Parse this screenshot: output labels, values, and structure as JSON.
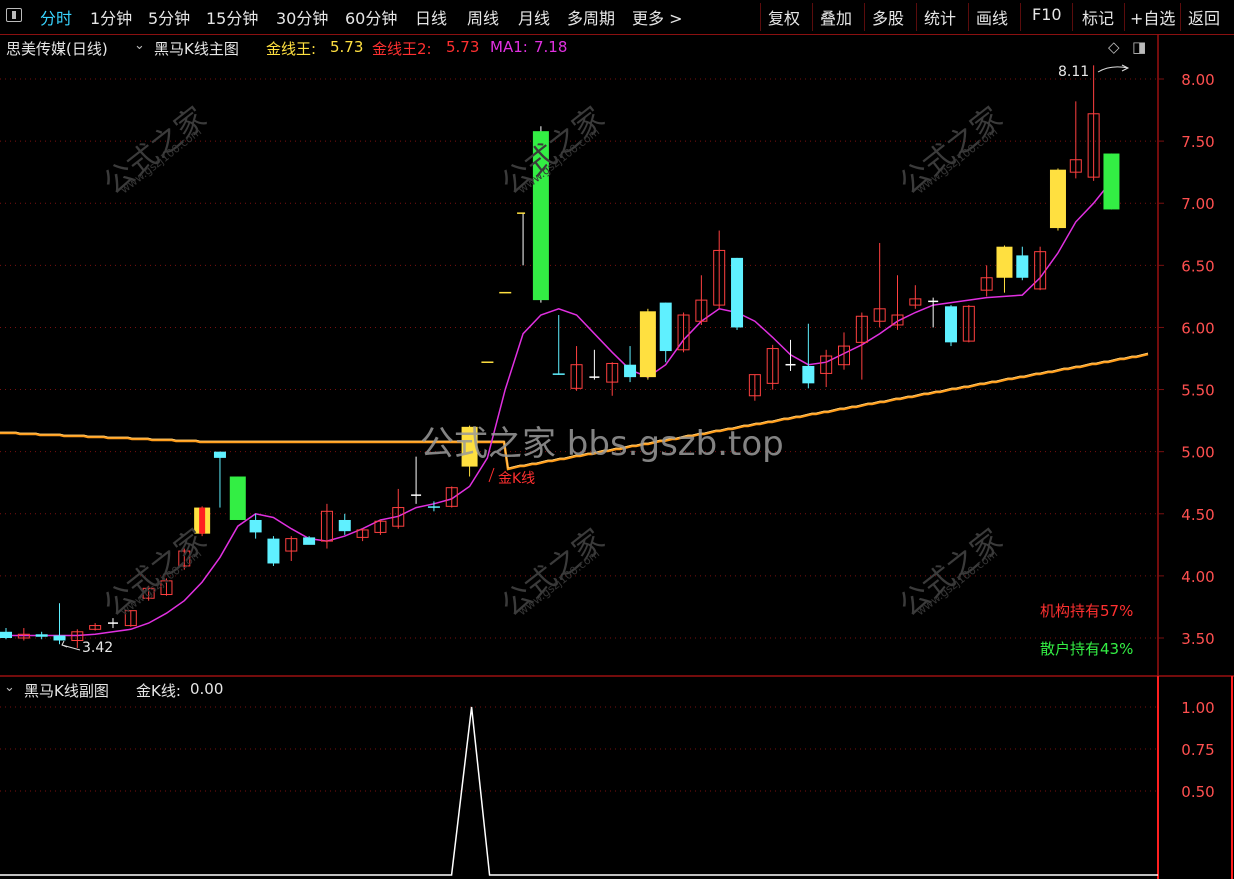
{
  "toolbar": {
    "items": [
      {
        "label": "分时",
        "active": true
      },
      {
        "label": "1分钟"
      },
      {
        "label": "5分钟"
      },
      {
        "label": "15分钟"
      },
      {
        "label": "30分钟"
      },
      {
        "label": "60分钟"
      },
      {
        "label": "日线"
      },
      {
        "label": "周线"
      },
      {
        "label": "月线"
      },
      {
        "label": "多周期"
      },
      {
        "label": "更多 >"
      }
    ],
    "right_buttons": [
      "复权",
      "叠加",
      "多股",
      "统计",
      "画线",
      "F10",
      "标记",
      "+自选",
      "返回"
    ]
  },
  "main_header": {
    "stock": "思美传媒(日线)",
    "indicator": "黑马K线主图",
    "gold1_label": "金线王:",
    "gold1_value": "5.73",
    "gold2_label": "金线王2:",
    "gold2_value": "5.73",
    "ma_label": "MA1:",
    "ma_value": "7.18"
  },
  "sub_header": {
    "indicator": "黑马K线副图",
    "label": "金K线:",
    "value": "0.00"
  },
  "annotations": {
    "high_label": "8.11",
    "low_label": "3.42",
    "gold_k": "金K线",
    "institution": "机构持有57%",
    "retail": "散户持有43%"
  },
  "watermark": {
    "center": "公式之家 bbs.gszb.top",
    "tile_text": "公式之家",
    "tile_url": "www.gszj100.com"
  },
  "colors": {
    "up": "#ff4040",
    "down": "#5ff0ff",
    "ma": "#e030e0",
    "gold_line": "#ff9c1a",
    "signal_yellow": "#ffe040",
    "signal_green": "#33ee44",
    "grid": "#7a1010",
    "axis_text": "#ff5050"
  },
  "chart_data": {
    "main": {
      "type": "candlestick",
      "y_ticks": [
        8.0,
        7.5,
        7.0,
        6.5,
        6.0,
        5.5,
        5.0,
        4.5,
        4.0,
        3.5
      ],
      "candles": [
        {
          "o": 3.55,
          "h": 3.58,
          "l": 3.49,
          "c": 3.5,
          "k": "down"
        },
        {
          "o": 3.5,
          "h": 3.58,
          "l": 3.48,
          "c": 3.53,
          "k": "up"
        },
        {
          "o": 3.53,
          "h": 3.55,
          "l": 3.49,
          "c": 3.51,
          "k": "down"
        },
        {
          "o": 3.52,
          "h": 3.78,
          "l": 3.45,
          "c": 3.48,
          "k": "down"
        },
        {
          "o": 3.48,
          "h": 3.57,
          "l": 3.42,
          "c": 3.55,
          "k": "up"
        },
        {
          "o": 3.57,
          "h": 3.62,
          "l": 3.56,
          "c": 3.6,
          "k": "up"
        },
        {
          "o": 3.62,
          "h": 3.66,
          "l": 3.58,
          "c": 3.62,
          "k": "doji"
        },
        {
          "o": 3.6,
          "h": 3.72,
          "l": 3.59,
          "c": 3.72,
          "k": "up"
        },
        {
          "o": 3.82,
          "h": 3.92,
          "l": 3.8,
          "c": 3.9,
          "k": "up"
        },
        {
          "o": 3.85,
          "h": 3.98,
          "l": 3.84,
          "c": 3.96,
          "k": "up"
        },
        {
          "o": 4.08,
          "h": 4.22,
          "l": 4.05,
          "c": 4.2,
          "k": "up"
        },
        {
          "o": 4.34,
          "h": 4.56,
          "l": 4.32,
          "c": 4.55,
          "k": "sig_red"
        },
        {
          "o": 5.0,
          "h": 5.0,
          "l": 4.55,
          "c": 4.95,
          "k": "down"
        },
        {
          "o": 4.8,
          "h": 4.8,
          "l": 4.45,
          "c": 4.45,
          "k": "sig_green"
        },
        {
          "o": 4.45,
          "h": 4.5,
          "l": 4.3,
          "c": 4.35,
          "k": "down"
        },
        {
          "o": 4.3,
          "h": 4.32,
          "l": 4.08,
          "c": 4.1,
          "k": "down"
        },
        {
          "o": 4.2,
          "h": 4.32,
          "l": 4.12,
          "c": 4.3,
          "k": "up"
        },
        {
          "o": 4.31,
          "h": 4.32,
          "l": 4.26,
          "c": 4.25,
          "k": "down"
        },
        {
          "o": 4.28,
          "h": 4.58,
          "l": 4.22,
          "c": 4.52,
          "k": "up"
        },
        {
          "o": 4.45,
          "h": 4.5,
          "l": 4.33,
          "c": 4.36,
          "k": "down"
        },
        {
          "o": 4.31,
          "h": 4.38,
          "l": 4.28,
          "c": 4.37,
          "k": "up"
        },
        {
          "o": 4.35,
          "h": 4.45,
          "l": 4.33,
          "c": 4.44,
          "k": "up"
        },
        {
          "o": 4.4,
          "h": 4.7,
          "l": 4.38,
          "c": 4.55,
          "k": "up"
        },
        {
          "o": 4.65,
          "h": 4.96,
          "l": 4.58,
          "c": 4.65,
          "k": "doji"
        },
        {
          "o": 4.56,
          "h": 4.6,
          "l": 4.52,
          "c": 4.55,
          "k": "down"
        },
        {
          "o": 4.56,
          "h": 4.72,
          "l": 4.55,
          "c": 4.71,
          "k": "up"
        },
        {
          "o": 4.88,
          "h": 5.21,
          "l": 4.8,
          "c": 5.2,
          "k": "sig_yellow"
        },
        {
          "o": 5.72,
          "h": 5.72,
          "l": 5.72,
          "c": 5.72,
          "k": "flat_yellow"
        },
        {
          "o": 6.28,
          "h": 6.28,
          "l": 6.28,
          "c": 6.28,
          "k": "flat_yellow"
        },
        {
          "o": 6.92,
          "h": 6.92,
          "l": 6.5,
          "c": 6.92,
          "k": "tick_yellow"
        },
        {
          "o": 7.58,
          "h": 7.62,
          "l": 6.2,
          "c": 6.22,
          "k": "sig_green"
        },
        {
          "o": 5.63,
          "h": 6.1,
          "l": 5.62,
          "c": 5.63,
          "k": "down"
        },
        {
          "o": 5.51,
          "h": 5.85,
          "l": 5.49,
          "c": 5.7,
          "k": "up"
        },
        {
          "o": 5.6,
          "h": 5.82,
          "l": 5.58,
          "c": 5.6,
          "k": "doji"
        },
        {
          "o": 5.56,
          "h": 5.72,
          "l": 5.45,
          "c": 5.71,
          "k": "up"
        },
        {
          "o": 5.7,
          "h": 5.85,
          "l": 5.56,
          "c": 5.6,
          "k": "down"
        },
        {
          "o": 5.6,
          "h": 6.15,
          "l": 5.58,
          "c": 6.13,
          "k": "sig_yellow"
        },
        {
          "o": 6.2,
          "h": 6.2,
          "l": 5.72,
          "c": 5.81,
          "k": "down"
        },
        {
          "o": 5.82,
          "h": 6.12,
          "l": 5.8,
          "c": 6.1,
          "k": "up"
        },
        {
          "o": 6.05,
          "h": 6.42,
          "l": 6.02,
          "c": 6.22,
          "k": "up"
        },
        {
          "o": 6.18,
          "h": 6.78,
          "l": 6.15,
          "c": 6.62,
          "k": "up"
        },
        {
          "o": 6.56,
          "h": 6.56,
          "l": 5.98,
          "c": 6.0,
          "k": "down"
        },
        {
          "o": 5.45,
          "h": 5.62,
          "l": 5.41,
          "c": 5.62,
          "k": "up"
        },
        {
          "o": 5.55,
          "h": 5.86,
          "l": 5.5,
          "c": 5.83,
          "k": "up"
        },
        {
          "o": 5.68,
          "h": 5.9,
          "l": 5.65,
          "c": 5.7,
          "k": "doji"
        },
        {
          "o": 5.69,
          "h": 6.03,
          "l": 5.51,
          "c": 5.55,
          "k": "down"
        },
        {
          "o": 5.63,
          "h": 5.82,
          "l": 5.52,
          "c": 5.77,
          "k": "up"
        },
        {
          "o": 5.7,
          "h": 5.96,
          "l": 5.66,
          "c": 5.85,
          "k": "up"
        },
        {
          "o": 5.88,
          "h": 6.12,
          "l": 5.58,
          "c": 6.09,
          "k": "up"
        },
        {
          "o": 6.05,
          "h": 6.68,
          "l": 6.0,
          "c": 6.15,
          "k": "up"
        },
        {
          "o": 6.02,
          "h": 6.42,
          "l": 5.98,
          "c": 6.1,
          "k": "up"
        },
        {
          "o": 6.18,
          "h": 6.34,
          "l": 6.15,
          "c": 6.23,
          "k": "up"
        },
        {
          "o": 6.2,
          "h": 6.24,
          "l": 6.0,
          "c": 6.21,
          "k": "doji"
        },
        {
          "o": 6.17,
          "h": 6.18,
          "l": 5.85,
          "c": 5.88,
          "k": "down"
        },
        {
          "o": 5.89,
          "h": 6.18,
          "l": 5.88,
          "c": 6.17,
          "k": "up"
        },
        {
          "o": 6.3,
          "h": 6.5,
          "l": 6.25,
          "c": 6.4,
          "k": "up"
        },
        {
          "o": 6.4,
          "h": 6.66,
          "l": 6.28,
          "c": 6.65,
          "k": "sig_yellow"
        },
        {
          "o": 6.58,
          "h": 6.65,
          "l": 6.38,
          "c": 6.4,
          "k": "down"
        },
        {
          "o": 6.31,
          "h": 6.65,
          "l": 6.3,
          "c": 6.61,
          "k": "up"
        },
        {
          "o": 6.8,
          "h": 7.28,
          "l": 6.78,
          "c": 7.27,
          "k": "sig_yellow"
        },
        {
          "o": 7.25,
          "h": 7.82,
          "l": 7.2,
          "c": 7.35,
          "k": "up"
        },
        {
          "o": 7.21,
          "h": 8.11,
          "l": 7.18,
          "c": 7.72,
          "k": "up"
        },
        {
          "o": 7.4,
          "h": 7.4,
          "l": 6.95,
          "c": 6.95,
          "k": "sig_green"
        }
      ],
      "ma1": [
        3.52,
        3.52,
        3.52,
        3.52,
        3.52,
        3.53,
        3.55,
        3.57,
        3.62,
        3.7,
        3.8,
        3.95,
        4.15,
        4.4,
        4.5,
        4.47,
        4.38,
        4.3,
        4.28,
        4.32,
        4.38,
        4.45,
        4.48,
        4.55,
        4.58,
        4.62,
        4.72,
        4.95,
        5.5,
        5.95,
        6.1,
        6.15,
        6.1,
        5.95,
        5.8,
        5.66,
        5.6,
        5.7,
        5.9,
        6.05,
        6.15,
        6.12,
        6.05,
        5.92,
        5.78,
        5.7,
        5.72,
        5.79,
        5.86,
        5.95,
        6.05,
        6.12,
        6.18,
        6.2,
        6.22,
        6.24,
        6.25,
        6.26,
        6.4,
        6.6,
        6.85,
        7.0,
        7.18
      ],
      "gold_line": {
        "start": 5.15,
        "mid_index": 11,
        "mid": 5.08,
        "flat_until": 28,
        "end": 5.73
      }
    },
    "sub": {
      "type": "line",
      "y_ticks": [
        1.0,
        0.75,
        0.5
      ],
      "peak_index": 26,
      "peak_value": 1.0
    }
  }
}
